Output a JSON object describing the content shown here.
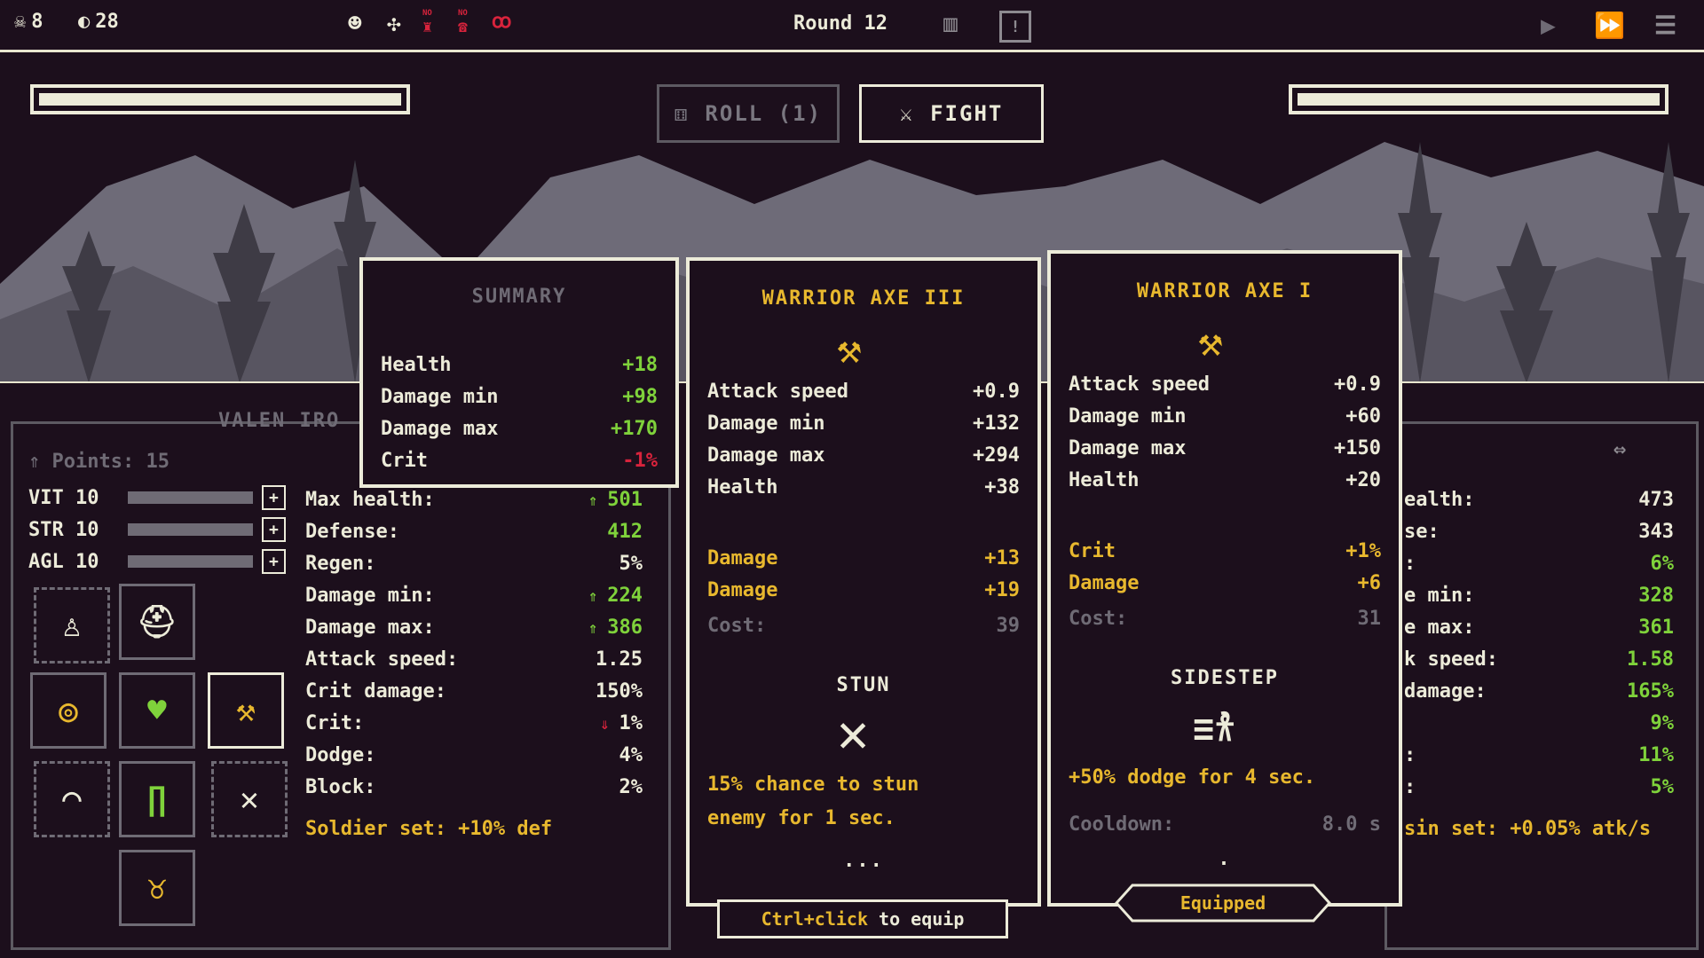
{
  "topbar": {
    "skulls": "8",
    "coins": "28",
    "badges": [
      "NO",
      "NO"
    ],
    "round": "Round 12",
    "icons": [
      "skull-icon",
      "coin-icon",
      "hooded-face-icon",
      "crossed-bones-icon",
      "no-trophy-icon",
      "no-heal-icon",
      "blood-drops-icon",
      "map-icon",
      "alert-icon",
      "play-icon",
      "fast-forward-icon",
      "menu-icon"
    ]
  },
  "controls": {
    "roll_label": "ROLL (1)",
    "fight_label": "FIGHT"
  },
  "summary": {
    "title": "SUMMARY",
    "rows": [
      {
        "label": "Health",
        "value": "+18",
        "tone": "green"
      },
      {
        "label": "Damage min",
        "value": "+98",
        "tone": "green"
      },
      {
        "label": "Damage max",
        "value": "+170",
        "tone": "green"
      },
      {
        "label": "Crit",
        "value": "-1%",
        "tone": "red"
      }
    ]
  },
  "item_new": {
    "title": "WARRIOR AXE III",
    "stats": [
      {
        "label": "Attack speed",
        "value": "+0.9"
      },
      {
        "label": "Damage min",
        "value": "+132"
      },
      {
        "label": "Damage max",
        "value": "+294"
      },
      {
        "label": "Health",
        "value": "+38"
      }
    ],
    "bonuses": [
      {
        "label": "Damage",
        "value": "+13"
      },
      {
        "label": "Damage",
        "value": "+19"
      }
    ],
    "cost_label": "Cost:",
    "cost": "39",
    "ability": "STUN",
    "desc1": "15% chance to stun",
    "desc2": "enemy for 1 sec.",
    "dots": "...",
    "equip_hint_key": "Ctrl+click",
    "equip_hint_rest": " to equip"
  },
  "item_equipped": {
    "title": "WARRIOR AXE I",
    "stats": [
      {
        "label": "Attack speed",
        "value": "+0.9"
      },
      {
        "label": "Damage min",
        "value": "+60"
      },
      {
        "label": "Damage max",
        "value": "+150"
      },
      {
        "label": "Health",
        "value": "+20"
      }
    ],
    "bonuses": [
      {
        "label": "Crit",
        "value": "+1%"
      },
      {
        "label": "Damage",
        "value": "+6"
      }
    ],
    "cost_label": "Cost:",
    "cost": "31",
    "ability": "SIDESTEP",
    "desc": "+50% dodge for 4 sec.",
    "cooldown_label": "Cooldown:",
    "cooldown": "8.0 s",
    "dots": ".",
    "badge": "Equipped"
  },
  "player": {
    "name": "VALEN IRO",
    "points": "Points: 15",
    "attributes": [
      {
        "label": "VIT 10"
      },
      {
        "label": "STR 10"
      },
      {
        "label": "AGL 10"
      }
    ],
    "stats": [
      {
        "label": "Max health:",
        "value": "501",
        "tone": "green",
        "arrow": "^"
      },
      {
        "label": "Defense:",
        "value": "412",
        "tone": "green",
        "arrow": ""
      },
      {
        "label": "Regen:",
        "value": "5%",
        "tone": "white",
        "arrow": ""
      },
      {
        "label": "Damage min:",
        "value": "224",
        "tone": "green",
        "arrow": "^"
      },
      {
        "label": "Damage max:",
        "value": "386",
        "tone": "green",
        "arrow": "^"
      },
      {
        "label": "Attack speed:",
        "value": "1.25",
        "tone": "white",
        "arrow": ""
      },
      {
        "label": "Crit damage:",
        "value": "150%",
        "tone": "white",
        "arrow": ""
      },
      {
        "label": "Crit:",
        "value": "1%",
        "tone": "white",
        "arrow": "v"
      },
      {
        "label": "Dodge:",
        "value": "4%",
        "tone": "white",
        "arrow": ""
      },
      {
        "label": "Block:",
        "value": "2%",
        "tone": "white",
        "arrow": ""
      }
    ],
    "set_bonus": "Soldier set: +10% def"
  },
  "enemy": {
    "swap_icon": "swap-arrows-icon",
    "stats": [
      {
        "label": "ealth:",
        "value": "473",
        "tone": "white"
      },
      {
        "label": "se:",
        "value": "343",
        "tone": "white"
      },
      {
        "label": ":",
        "value": "6%",
        "tone": "green"
      },
      {
        "label": "e min:",
        "value": "328",
        "tone": "green"
      },
      {
        "label": "e max:",
        "value": "361",
        "tone": "green"
      },
      {
        "label": "k speed:",
        "value": "1.58",
        "tone": "green"
      },
      {
        "label": "damage:",
        "value": "165%",
        "tone": "green"
      },
      {
        "label": "",
        "value": "9%",
        "tone": "green"
      },
      {
        "label": ":",
        "value": "11%",
        "tone": "green"
      },
      {
        "label": ":",
        "value": "5%",
        "tone": "green"
      }
    ],
    "set_bonus": "sin set: +0.05% atk/s"
  },
  "colors": {
    "bg": "#1c0f1c",
    "fg": "#ecebd9",
    "gold": "#e8b82e",
    "green": "#7fd23b",
    "red": "#d8233c",
    "dim": "#6f6b75"
  }
}
